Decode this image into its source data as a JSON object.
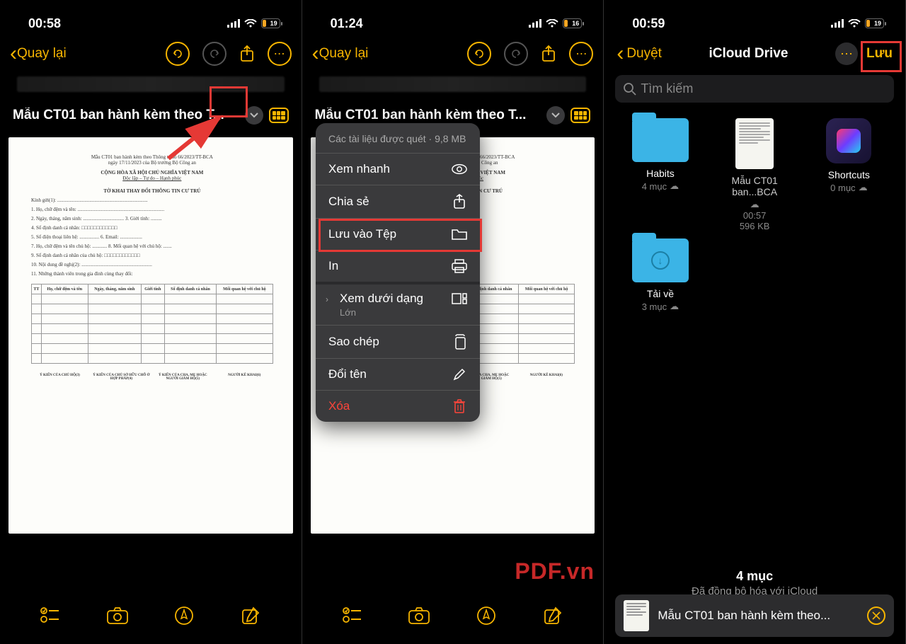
{
  "phones": [
    {
      "time": "00:58",
      "battery": "19"
    },
    {
      "time": "01:24",
      "battery": "16"
    },
    {
      "time": "00:59",
      "battery": "19"
    }
  ],
  "nav": {
    "back": "Quay lại"
  },
  "doc": {
    "title": "Mẫu CT01 ban hành kèm theo T...",
    "h1": "Mẫu CT01 ban hành kèm theo Thông tư số 66/2023/TT-BCA",
    "h1b": "ngày 17/11/2023 của Bộ trưởng Bộ Công an",
    "h2": "CỘNG HÒA XÃ HỘI CHỦ NGHĨA VIỆT NAM",
    "h3": "Độc lập – Tự do – Hạnh phúc",
    "h4": "TỜ KHAI THAY ĐỔI THÔNG TIN CƯ TRÚ",
    "lines": [
      "Kính gửi(1): .........................................................................",
      "1. Họ, chữ đệm và tên: ......................................................................",
      "2. Ngày, tháng, năm sinh: ................................. 3. Giới tính: .........",
      "4. Số định danh cá nhân: □□□□□□□□□□□□",
      "5. Số điện thoại liên hệ: ................ 6. Email: ..................",
      "7. Họ, chữ đệm và tên chủ hộ: ............ 8. Mối quan hệ với chủ hộ: .......",
      "9. Số định danh cá nhân của chủ hộ: □□□□□□□□□□□□",
      "10. Nội dung đề nghị(2): .........................................................",
      "",
      "11. Những thành viên trong gia đình cùng thay đổi:"
    ],
    "tbl_headers": [
      "TT",
      "Họ, chữ đệm và tên",
      "Ngày, tháng, năm sinh",
      "Giới tính",
      "Số định danh cá nhân",
      "Mối quan hệ với chủ hộ"
    ],
    "sig": [
      "Ý KIẾN CỦA CHỦ HỘ(3)",
      "Ý KIẾN CỦA CHỦ SỞ HỮU CHỖ Ở HỢP PHÁP(4)",
      "Ý KIẾN CỦA CHA, MẸ HOẶC NGƯỜI GIÁM HỘ(5)",
      "NGƯỜI KÊ KHAI(6)"
    ]
  },
  "popup": {
    "header": "Các tài liệu được quét · 9,8 MB",
    "items": [
      {
        "label": "Xem nhanh",
        "icon": "eye"
      },
      {
        "label": "Chia sẻ",
        "icon": "share"
      },
      {
        "label": "Lưu vào Tệp",
        "icon": "folder"
      },
      {
        "label": "In",
        "icon": "printer"
      },
      {
        "label": "Xem dưới dạng",
        "sub": "Lớn",
        "icon": "layout"
      },
      {
        "label": "Sao chép",
        "icon": "copy"
      },
      {
        "label": "Đổi tên",
        "icon": "pencil"
      },
      {
        "label": "Xóa",
        "icon": "trash",
        "red": true
      }
    ]
  },
  "drive": {
    "back": "Duyệt",
    "title": "iCloud Drive",
    "save": "Lưu",
    "search_ph": "Tìm kiếm",
    "items": [
      {
        "name": "Habits",
        "sub": "4 mục",
        "type": "folder",
        "cloud": true
      },
      {
        "name": "Mẫu CT01 ban...BCA",
        "sub1": "00:57",
        "sub2": "596 KB",
        "type": "doc",
        "cloud": true
      },
      {
        "name": "Shortcuts",
        "sub": "0 mục",
        "type": "app",
        "cloud": true
      },
      {
        "name": "Tải về",
        "sub": "3 mục",
        "type": "dl",
        "cloud": true
      }
    ],
    "footer": {
      "count": "4 mục",
      "sync": "Đã đồng bộ hóa với iCloud"
    },
    "edit": "Mẫu CT01 ban hành kèm theo..."
  }
}
